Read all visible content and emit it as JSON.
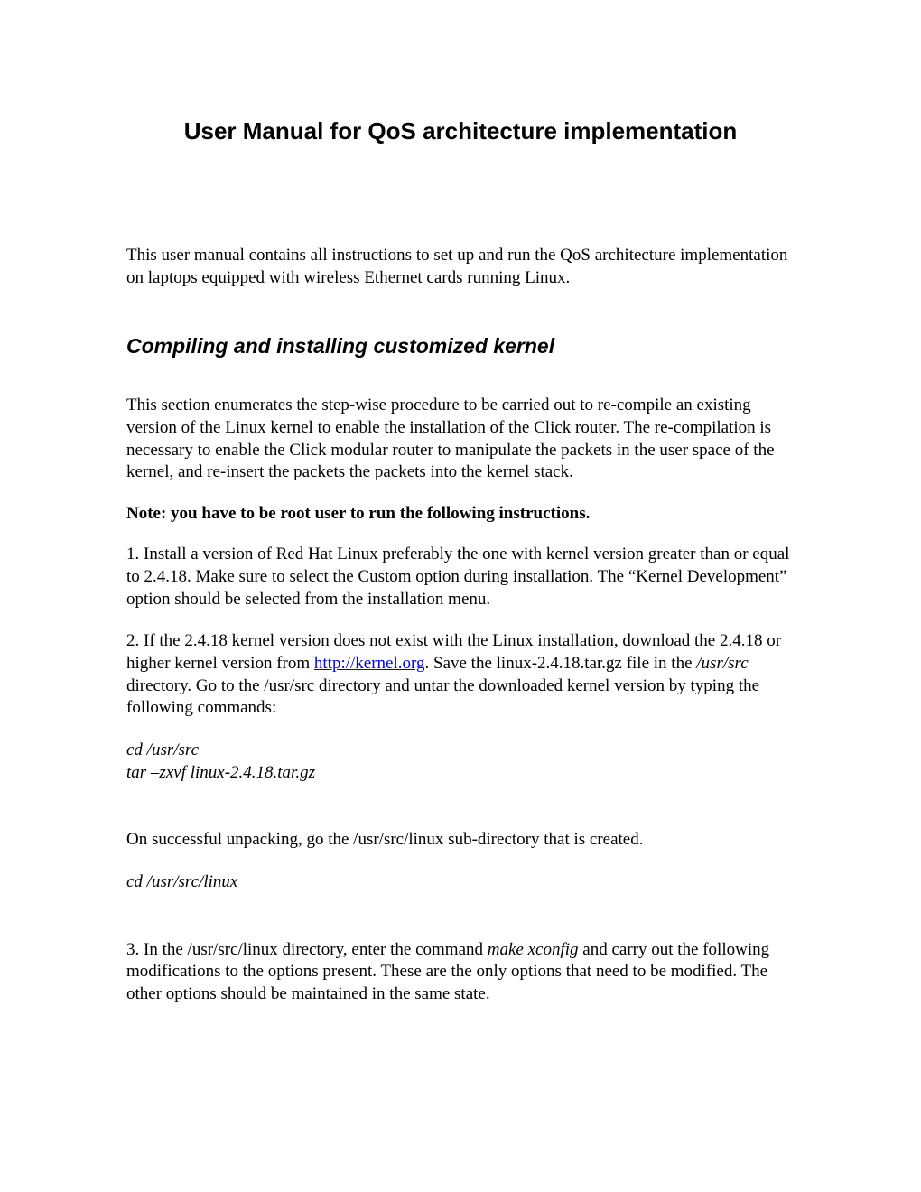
{
  "title": "User Manual for QoS architecture implementation",
  "intro": "This user manual contains all instructions to set up and run the QoS architecture implementation on laptops equipped with wireless Ethernet cards running Linux.",
  "section_heading": "Compiling and installing customized kernel",
  "para1": "This section enumerates the step-wise procedure to be carried out to re-compile an existing version of the Linux kernel to enable the installation of the Click router. The re-compilation is necessary to enable the Click modular router to manipulate the packets in the user space of the kernel, and re-insert the packets the packets into the kernel stack.",
  "note": "Note: you have to be root user to run the following instructions.",
  "step1": "1. Install a version of Red Hat Linux preferably the one with kernel version greater than or equal to 2.4.18. Make sure to select the Custom option during installation. The “Kernel Development” option should be selected from the installation menu.",
  "step2_a": "2. If the 2.4.18 kernel version does not exist with the Linux installation, download the 2.4.18 or higher kernel version from ",
  "step2_link": "http://kernel.org",
  "step2_b": ". Save the linux-2.4.18.tar.gz file in the ",
  "step2_italic": "/usr/src",
  "step2_c": " directory.  Go to the /usr/src directory and untar the downloaded kernel version by typing the following commands:",
  "cmd1_line1": "cd /usr/src",
  "cmd1_line2": "tar –zxvf  linux-2.4.18.tar.gz",
  "para_unpack": "On successful unpacking, go the /usr/src/linux sub-directory that is created.",
  "cmd2": "cd /usr/src/linux",
  "step3_a": "3. In the /usr/src/linux directory, enter the command ",
  "step3_italic": "make xconfig",
  "step3_b": " and carry out the following modifications to the options present. These are the only options that need to be modified. The other options should be maintained in the same state."
}
